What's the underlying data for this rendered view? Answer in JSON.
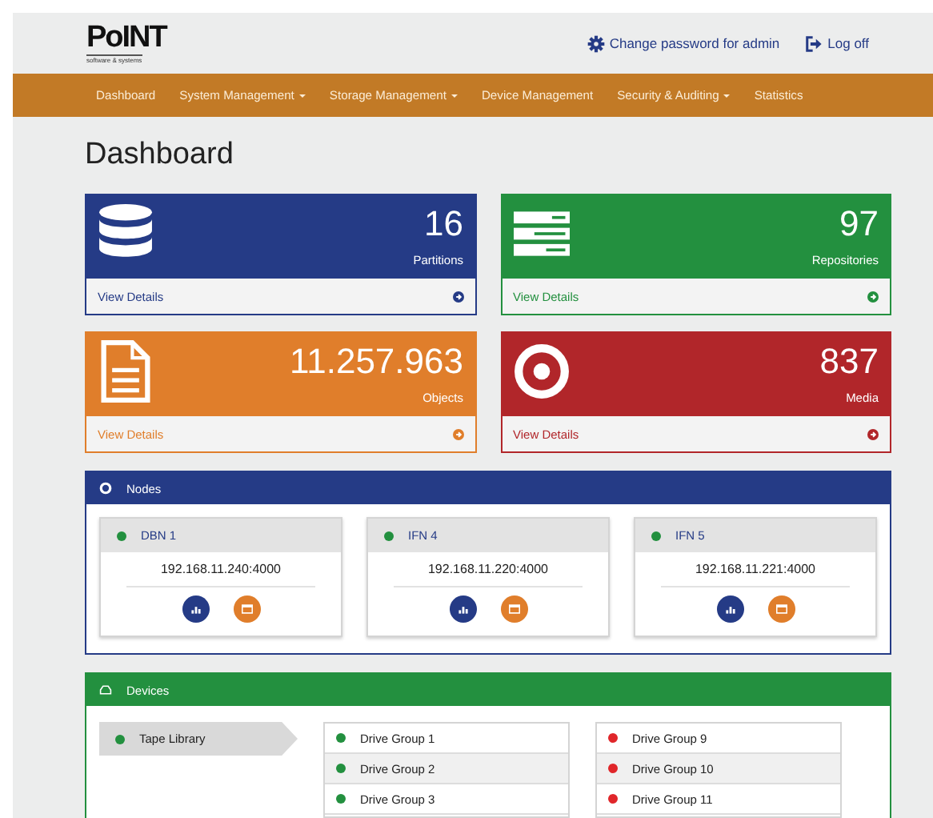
{
  "header": {
    "logo": {
      "name": "PoINT",
      "tagline": "software & systems"
    },
    "links": [
      {
        "kind": "settings",
        "label": "Change password for admin"
      },
      {
        "kind": "logout",
        "label": "Log off"
      }
    ]
  },
  "nav": [
    {
      "label": "Dashboard",
      "dropdown": false
    },
    {
      "label": "System Management",
      "dropdown": true
    },
    {
      "label": "Storage Management",
      "dropdown": true
    },
    {
      "label": "Device Management",
      "dropdown": false
    },
    {
      "label": "Security & Auditing",
      "dropdown": true
    },
    {
      "label": "Statistics",
      "dropdown": false
    }
  ],
  "title": "Dashboard",
  "stats": [
    {
      "kind": "database",
      "count": "16",
      "label": "Partitions",
      "link": "View Details",
      "color": "#253b86"
    },
    {
      "kind": "server",
      "count": "97",
      "label": "Repositories",
      "link": "View Details",
      "color": "#23903f"
    },
    {
      "kind": "document",
      "count": "11.257.963",
      "label": "Objects",
      "link": "View Details",
      "color": "#e07e2b"
    },
    {
      "kind": "target",
      "count": "837",
      "label": "Media",
      "link": "View Details",
      "color": "#b1262a"
    }
  ],
  "nodes": {
    "title": "Nodes",
    "items": [
      {
        "name": "DBN 1",
        "address": "192.168.11.240:4000",
        "color": "#23903f"
      },
      {
        "name": "IFN 4",
        "address": "192.168.11.220:4000",
        "color": "#23903f"
      },
      {
        "name": "IFN 5",
        "address": "192.168.11.221:4000",
        "color": "#23903f"
      }
    ]
  },
  "devices": {
    "title": "Devices",
    "libraries": [
      {
        "name": "Tape Library",
        "color": "#23903f",
        "selected": true
      }
    ],
    "drive_groups": [
      [
        {
          "name": "Drive Group 1",
          "color": "#23903f"
        },
        {
          "name": "Drive Group 2",
          "color": "#23903f"
        },
        {
          "name": "Drive Group 3",
          "color": "#23903f"
        }
      ],
      [
        {
          "name": "Drive Group 9",
          "color": "#e0262a"
        },
        {
          "name": "Drive Group 10",
          "color": "#e0262a"
        },
        {
          "name": "Drive Group 11",
          "color": "#e0262a"
        }
      ]
    ]
  }
}
